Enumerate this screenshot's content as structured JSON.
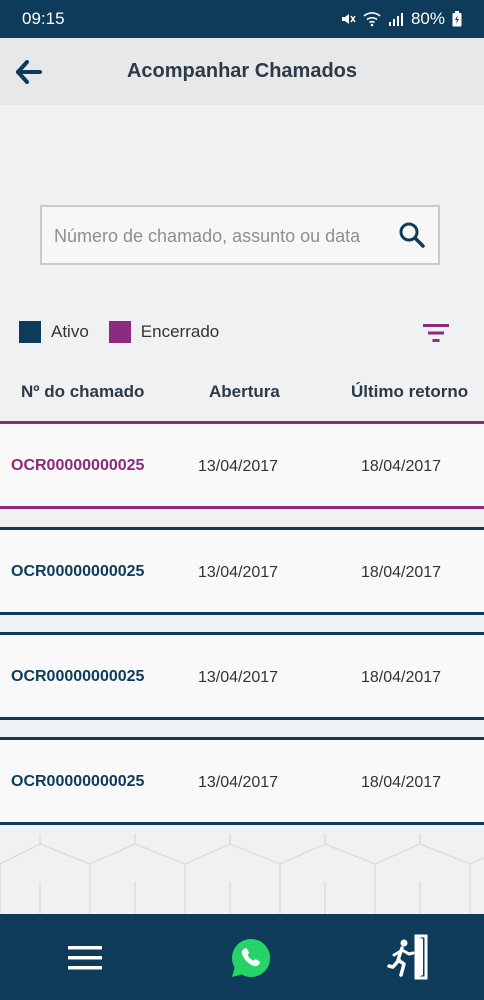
{
  "status_bar": {
    "time": "09:15",
    "battery": "80%"
  },
  "header": {
    "title": "Acompanhar Chamados",
    "back_icon": "back-arrow-icon"
  },
  "search": {
    "placeholder": "Número de chamado, assunto ou data",
    "value": ""
  },
  "legend": {
    "active_label": "Ativo",
    "closed_label": "Encerrado",
    "active_color": "#0e3b5a",
    "closed_color": "#8b2a7e"
  },
  "table": {
    "columns": [
      "Nº do chamado",
      "Abertura",
      "Último retorno"
    ],
    "rows": [
      {
        "id": "OCR00000000025",
        "opened": "13/04/2017",
        "last_return": "18/04/2017",
        "status": "Encerrado"
      },
      {
        "id": "OCR00000000025",
        "opened": "13/04/2017",
        "last_return": "18/04/2017",
        "status": "Ativo"
      },
      {
        "id": "OCR00000000025",
        "opened": "13/04/2017",
        "last_return": "18/04/2017",
        "status": "Ativo"
      },
      {
        "id": "OCR00000000025",
        "opened": "13/04/2017",
        "last_return": "18/04/2017",
        "status": "Ativo"
      }
    ]
  },
  "bottom_nav": {
    "icons": [
      "hamburger-menu-icon",
      "whatsapp-icon",
      "exit-door-icon"
    ]
  }
}
